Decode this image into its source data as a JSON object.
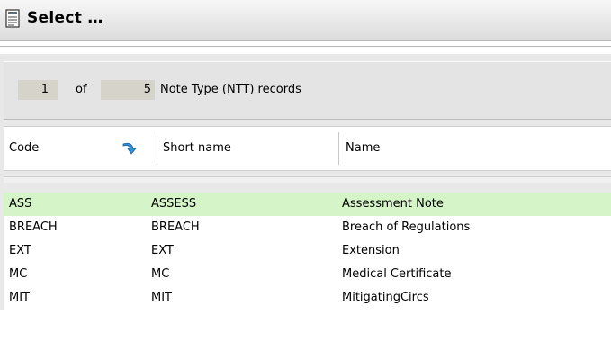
{
  "window": {
    "title": "Select …",
    "icon": "document-icon"
  },
  "counter": {
    "current": "1",
    "of_label": "of",
    "total": "5",
    "records_label": "Note Type (NTT) records"
  },
  "table": {
    "columns": [
      {
        "label": "Code"
      },
      {
        "label": "Short name"
      },
      {
        "label": "Name"
      }
    ],
    "sort_icon": "sort-arrow-icon",
    "rows": [
      {
        "code": "ASS",
        "short_name": "ASSESS",
        "name": "Assessment Note",
        "selected": true
      },
      {
        "code": "BREACH",
        "short_name": "BREACH",
        "name": "Breach of Regulations",
        "selected": false
      },
      {
        "code": "EXT",
        "short_name": "EXT",
        "name": "Extension",
        "selected": false
      },
      {
        "code": "MC",
        "short_name": "MC",
        "name": "Medical Certificate",
        "selected": false
      },
      {
        "code": "MIT",
        "short_name": "MIT",
        "name": "MitigatingCircs",
        "selected": false
      }
    ]
  },
  "colors": {
    "selected_row": "#d5f5c8",
    "number_box": "#d6d3cb",
    "sort_icon_blue": "#2f8fd8"
  }
}
